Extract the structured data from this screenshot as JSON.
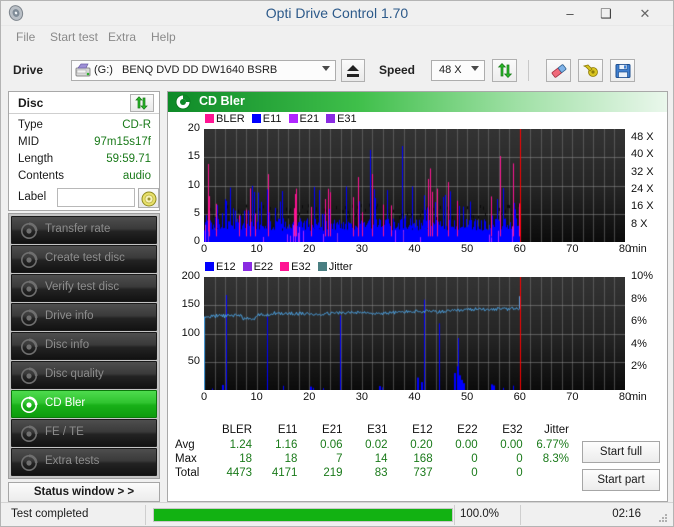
{
  "window": {
    "title": "Opti Drive Control 1.70",
    "icon": "disc-icon",
    "minimize": "–",
    "maximize": "❑",
    "close": "✕"
  },
  "menu": {
    "items": [
      {
        "label": "File",
        "name": "menu-file"
      },
      {
        "label": "Start test",
        "name": "menu-start-test"
      },
      {
        "label": "Extra",
        "name": "menu-extra"
      },
      {
        "label": "Help",
        "name": "menu-help"
      }
    ]
  },
  "toolbar": {
    "drive_label": "Drive",
    "drive_letter": "(G:)",
    "drive_name": "BENQ DVD DD DW1640 BSRB",
    "eject_title": "eject",
    "speed_label": "Speed",
    "speed_value": "48 X",
    "icons": {
      "refresh": "refresh-icon",
      "eraser": "eraser-icon",
      "wrench": "wrench-icon",
      "save": "save-icon"
    }
  },
  "disc": {
    "header": "Disc",
    "refresh_icon": "refresh-icon",
    "fields": [
      {
        "key": "Type",
        "value": "CD-R"
      },
      {
        "key": "MID",
        "value": "97m15s17f"
      },
      {
        "key": "Length",
        "value": "59:59.71"
      },
      {
        "key": "Contents",
        "value": "audio"
      }
    ],
    "label_key": "Label",
    "label_value": "",
    "label_placeholder": "",
    "label_button_icon": "cd-disc-icon"
  },
  "sidebar": {
    "items": [
      {
        "label": "Transfer rate",
        "name": "sidebar-item-transfer-rate",
        "icon": "disc-icon",
        "active": false
      },
      {
        "label": "Create test disc",
        "name": "sidebar-item-create-test-disc",
        "icon": "disc-icon",
        "active": false
      },
      {
        "label": "Verify test disc",
        "name": "sidebar-item-verify-test-disc",
        "icon": "disc-icon",
        "active": false
      },
      {
        "label": "Drive info",
        "name": "sidebar-item-drive-info",
        "icon": "disc-icon",
        "active": false
      },
      {
        "label": "Disc info",
        "name": "sidebar-item-disc-info",
        "icon": "disc-icon",
        "active": false
      },
      {
        "label": "Disc quality",
        "name": "sidebar-item-disc-quality",
        "icon": "disc-icon",
        "active": false
      },
      {
        "label": "CD Bler",
        "name": "sidebar-item-cd-bler",
        "icon": "disc-icon",
        "active": true
      },
      {
        "label": "FE / TE",
        "name": "sidebar-item-fe-te",
        "icon": "disc-icon",
        "active": false
      },
      {
        "label": "Extra tests",
        "name": "sidebar-item-extra-tests",
        "icon": "disc-icon",
        "active": false
      }
    ],
    "status_window_button": "Status window > >"
  },
  "panel": {
    "title": "CD Bler",
    "icon": "disc-icon"
  },
  "actions": {
    "start_full": "Start full",
    "start_part": "Start part"
  },
  "statusbar": {
    "text": "Test completed",
    "percent_label": "100.0%",
    "percent_value": 100,
    "time": "02:16"
  },
  "stats": {
    "columns": [
      "BLER",
      "E11",
      "E21",
      "E31",
      "E12",
      "E22",
      "E32",
      "Jitter"
    ],
    "rows": [
      {
        "label": "Avg",
        "values": [
          "1.24",
          "1.16",
          "0.06",
          "0.02",
          "0.20",
          "0.00",
          "0.00",
          "6.77%"
        ]
      },
      {
        "label": "Max",
        "values": [
          "18",
          "18",
          "7",
          "14",
          "168",
          "0",
          "0",
          "8.3%"
        ]
      },
      {
        "label": "Total",
        "values": [
          "4473",
          "4171",
          "219",
          "83",
          "737",
          "0",
          "0",
          ""
        ]
      }
    ]
  },
  "colors": {
    "bler": "#ff1493",
    "e11": "#0000ff",
    "e21": "#b026ff",
    "e31": "#8a2be2",
    "e12": "#0000ff",
    "e22": "#8a2be2",
    "e32": "#ff1493",
    "jitter": "#4da6e8",
    "marker_line": "#ff0000",
    "accent_green": "#19b219",
    "value_green": "#1a7a1a",
    "plot_bg": "#2b2b2b"
  },
  "chart_data": [
    {
      "type": "bar",
      "name": "cd-bler-chart",
      "title": "",
      "xlabel": "min",
      "ylabel": "",
      "xlim": [
        0,
        80
      ],
      "ylim": [
        0,
        20
      ],
      "xticks": [
        0,
        10,
        20,
        30,
        40,
        50,
        60,
        70,
        80
      ],
      "xticklabels": [
        "0",
        "10",
        "20",
        "30",
        "40",
        "50",
        "60",
        "70",
        "80"
      ],
      "yticks": [
        0,
        5,
        10,
        15,
        20
      ],
      "yticklabels": [
        "0",
        "5",
        "10",
        "15",
        "20"
      ],
      "y2label": "X",
      "y2lim": [
        0,
        52
      ],
      "y2ticks": [
        8,
        16,
        24,
        32,
        40,
        48
      ],
      "y2ticklabels": [
        "8 X",
        "16 X",
        "24 X",
        "32 X",
        "40 X",
        "48 X"
      ],
      "grid": true,
      "legend": [
        {
          "label": "BLER",
          "color": "#ff1493"
        },
        {
          "label": "E11",
          "color": "#0000ff"
        },
        {
          "label": "E21",
          "color": "#b026ff"
        },
        {
          "label": "E31",
          "color": "#8a2be2"
        }
      ],
      "data_end_x": 60,
      "marker_x": 60,
      "series": [
        {
          "name": "E11",
          "color": "#0000ff",
          "stat_avg": 1.16,
          "stat_max": 18,
          "stat_total": 4171,
          "baseline": 2.4
        },
        {
          "name": "BLER",
          "color": "#ff1493",
          "stat_avg": 1.24,
          "stat_max": 18,
          "stat_total": 4473,
          "baseline": 1.2
        },
        {
          "name": "E21",
          "color": "#b026ff",
          "stat_avg": 0.06,
          "stat_max": 7,
          "stat_total": 219,
          "baseline": 0.1
        },
        {
          "name": "E31",
          "color": "#8a2be2",
          "stat_avg": 0.02,
          "stat_max": 14,
          "stat_total": 83,
          "baseline": 0.05
        }
      ]
    },
    {
      "type": "line",
      "name": "jitter-chart",
      "title": "",
      "xlabel": "min",
      "ylabel": "",
      "xlim": [
        0,
        80
      ],
      "ylim": [
        0,
        200
      ],
      "xticks": [
        0,
        10,
        20,
        30,
        40,
        50,
        60,
        70,
        80
      ],
      "xticklabels": [
        "0",
        "10",
        "20",
        "30",
        "40",
        "50",
        "60",
        "70",
        "80"
      ],
      "yticks": [
        50,
        100,
        150,
        200
      ],
      "yticklabels": [
        "50",
        "100",
        "150",
        "200"
      ],
      "y2label": "%",
      "y2lim": [
        0,
        10
      ],
      "y2ticks": [
        2,
        4,
        6,
        8,
        10
      ],
      "y2ticklabels": [
        "2%",
        "4%",
        "6%",
        "8%",
        "10%"
      ],
      "grid": true,
      "legend": [
        {
          "label": "E12",
          "color": "#0000ff"
        },
        {
          "label": "E22",
          "color": "#8a2be2"
        },
        {
          "label": "E32",
          "color": "#ff1493"
        },
        {
          "label": "Jitter",
          "color": "#4a7f82"
        }
      ],
      "data_end_x": 60,
      "marker_x": 60,
      "jitter_avg_pct": 6.77,
      "jitter_max_pct": 8.3,
      "jitter_baseline_pct": 6.8,
      "series": [
        {
          "name": "Jitter",
          "color": "#4da6e8"
        },
        {
          "name": "E12",
          "color": "#0000ff",
          "stat_avg": 0.2,
          "stat_max": 168,
          "stat_total": 737
        },
        {
          "name": "E22",
          "color": "#8a2be2",
          "stat_avg": 0.0,
          "stat_max": 0,
          "stat_total": 0
        },
        {
          "name": "E32",
          "color": "#ff1493",
          "stat_avg": 0.0,
          "stat_max": 0,
          "stat_total": 0
        }
      ]
    }
  ]
}
